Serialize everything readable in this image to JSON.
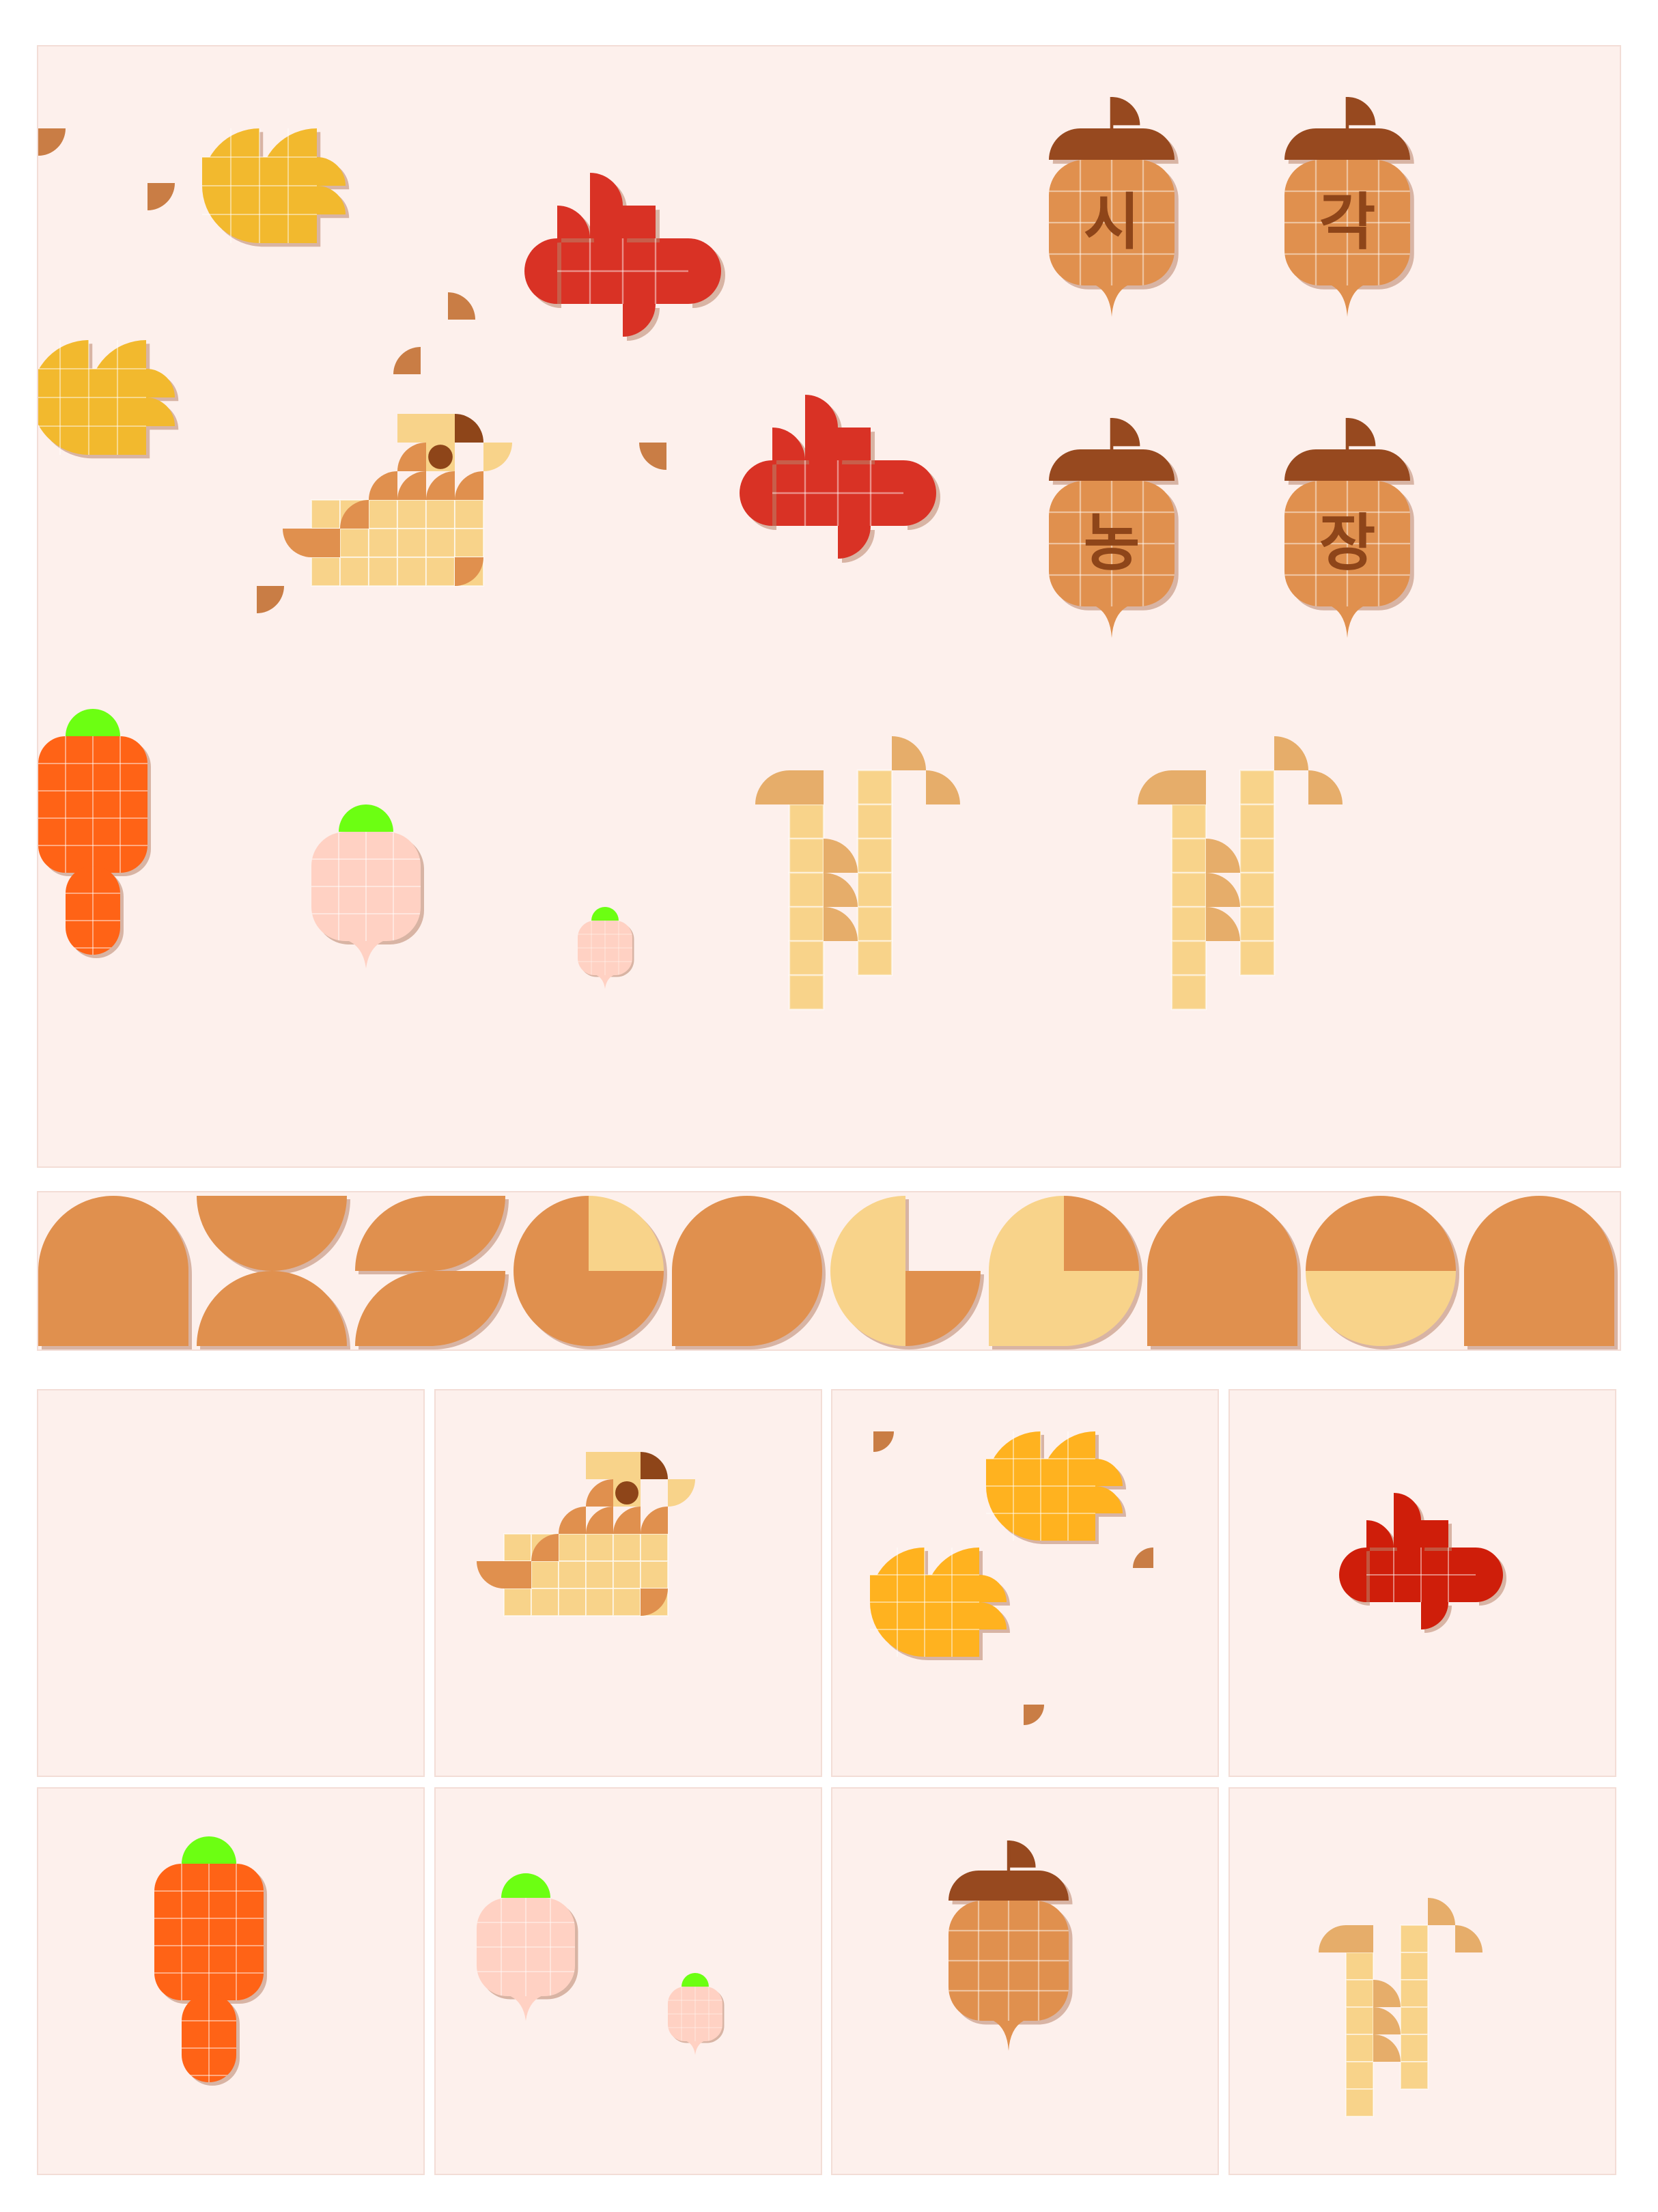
{
  "acorn_labels": [
    "시",
    "각",
    "농",
    "장"
  ],
  "colors": {
    "background": "#fdf0ec",
    "leaf_yellow": "#f2b92e",
    "maple_red": "#d93225",
    "acorn_cap": "#97491f",
    "acorn_body": "#e0904e",
    "carrot": "#ff6316",
    "radish": "#ffd1c3",
    "greens": "#6cff12",
    "wheat": "#f8d38a",
    "wheat_dark": "#e6ad6a",
    "bird_body": "#f8d38a",
    "bird_dark": "#e0904e",
    "bird_eye": "#8e4519",
    "letter_tan": "#e0904e",
    "letter_cream": "#f8d38a"
  },
  "icons": [
    "yellow-leaf-icon",
    "maple-leaf-icon",
    "acorn-icon",
    "bird-icon",
    "carrot-icon",
    "radish-icon",
    "wheat-icon"
  ]
}
